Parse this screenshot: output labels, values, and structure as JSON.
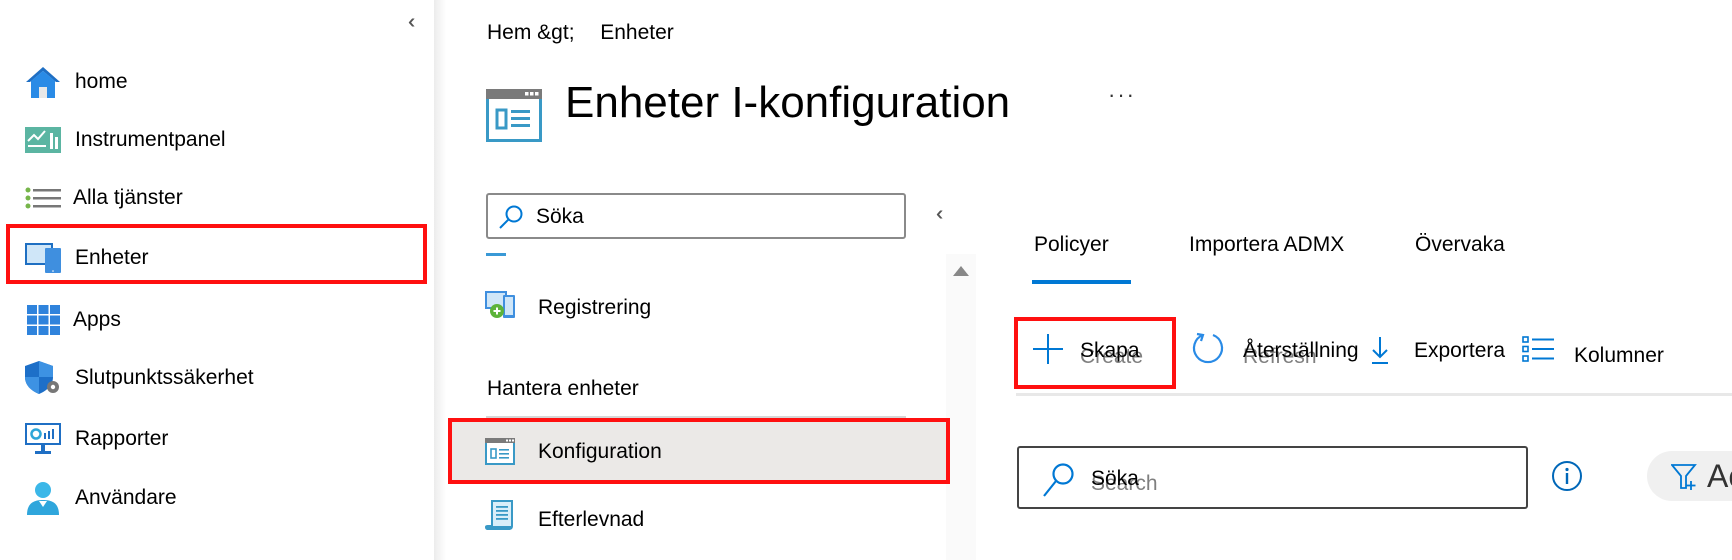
{
  "left_nav": {
    "collapse_label": "«",
    "items": [
      {
        "label": "home",
        "icon": "home-icon"
      },
      {
        "label": "Instrumentpanel",
        "icon": "dashboard-icon"
      },
      {
        "label": "Alla tjänster",
        "icon": "all-services-icon"
      },
      {
        "label": "Enheter",
        "icon": "devices-icon",
        "highlighted": true
      },
      {
        "label": "Apps",
        "icon": "apps-icon"
      },
      {
        "label": "Slutpunktssäkerhet",
        "icon": "endpoint-security-icon"
      },
      {
        "label": "Rapporter",
        "icon": "reports-icon"
      },
      {
        "label": "Användare",
        "icon": "users-icon"
      }
    ]
  },
  "breadcrumb": {
    "items": [
      "Hem &gt;",
      "Enheter"
    ]
  },
  "page": {
    "title": "Enheter I-konfiguration",
    "more_label": "···"
  },
  "submenu": {
    "search_placeholder": "Söka",
    "collapse_label": "«",
    "items": [
      {
        "label": "Registrering",
        "icon": "enrollment-icon"
      }
    ],
    "section_header": "Hantera enheter",
    "section_items": [
      {
        "label": "Konfiguration",
        "icon": "configuration-icon",
        "selected": true
      },
      {
        "label": "Efterlevnad",
        "icon": "compliance-icon"
      }
    ]
  },
  "tabs": [
    {
      "label": "Policyer",
      "active": true
    },
    {
      "label": "Importera ADMX",
      "active": false
    },
    {
      "label": "Övervaka",
      "active": false
    }
  ],
  "toolbar": {
    "create_label": "Skapa",
    "create_ghost": "Create",
    "refresh_label": "Återställning",
    "refresh_ghost": "Refresh",
    "export_label": "Exportera",
    "columns_label": "Kolumner"
  },
  "list": {
    "search_placeholder": "Söka",
    "search_ghost": "Search",
    "filter_label": "Ac"
  },
  "colors": {
    "accent": "#0078d4",
    "highlight": "#ff1010",
    "selected_bg": "#ebe9e7"
  }
}
